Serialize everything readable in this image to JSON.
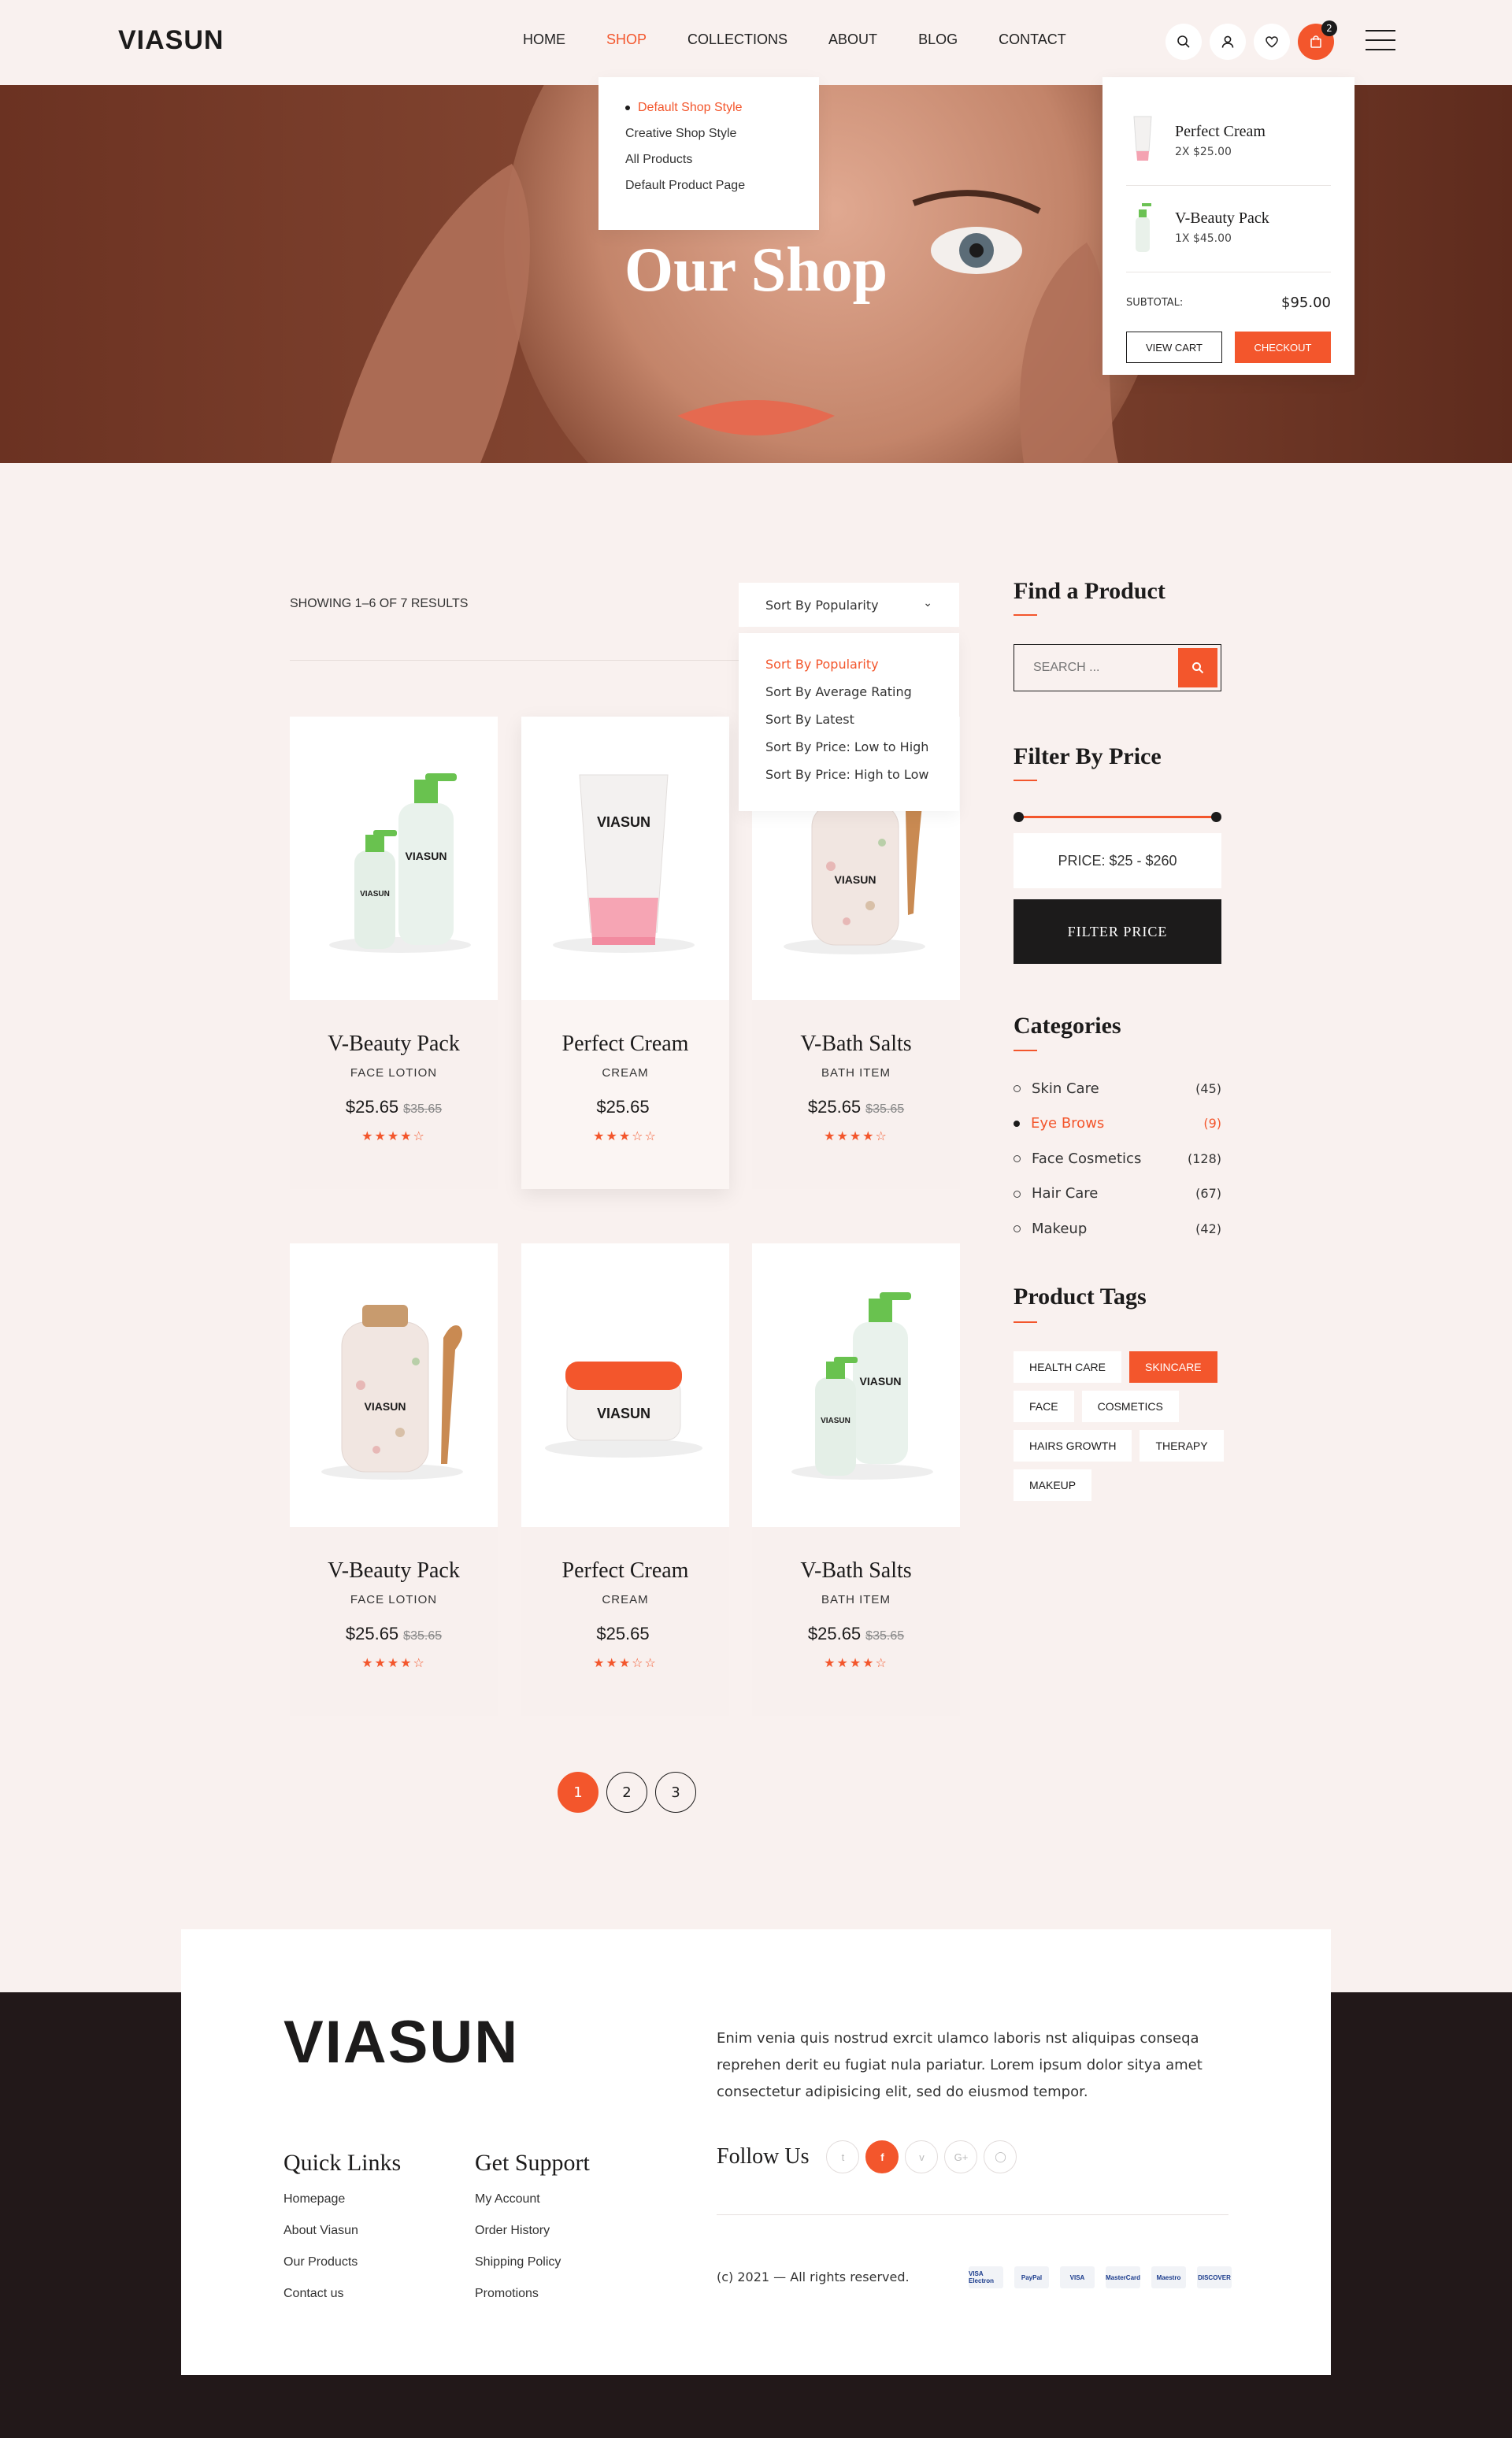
{
  "brand": {
    "logo": "VIASUN"
  },
  "nav": {
    "items": [
      "HOME",
      "SHOP",
      "COLLECTIONS",
      "ABOUT",
      "BLOG",
      "CONTACT"
    ],
    "active_index": 1
  },
  "shop_dropdown": {
    "items": [
      "Default Shop Style",
      "Creative Shop Style",
      "All Products",
      "Default Product Page"
    ]
  },
  "header_icons": [
    "search-icon",
    "user-icon",
    "heart-icon",
    "cart-icon"
  ],
  "cart": {
    "count": "2",
    "items": [
      {
        "name": "Perfect Cream",
        "qty": "2X $25.00"
      },
      {
        "name": "V-Beauty Pack",
        "qty": "1X $45.00"
      }
    ],
    "subtotal_label": "SUBTOTAL:",
    "subtotal": "$95.00",
    "view_cart": "VIEW CART",
    "checkout": "CHECKOUT"
  },
  "hero": {
    "title": "Our Shop"
  },
  "toolbar": {
    "result_count": "SHOWING 1–6 OF 7 RESULTS",
    "sort_selected": "Sort By Popularity",
    "sort_options": [
      "Sort By Popularity",
      "Sort By Average Rating",
      "Sort By Latest",
      "Sort By Price: Low to High",
      "Sort By Price: High to Low"
    ]
  },
  "products": [
    {
      "name": "V-Beauty Pack",
      "category": "FACE LOTION",
      "price": "$25.65",
      "old_price": "$35.65",
      "rating": 4
    },
    {
      "name": "Perfect Cream",
      "category": "CREAM",
      "price": "$25.65",
      "old_price": "",
      "rating": 3
    },
    {
      "name": "V-Bath Salts",
      "category": "BATH ITEM",
      "price": "$25.65",
      "old_price": "$35.65",
      "rating": 4
    },
    {
      "name": "V-Beauty Pack",
      "category": "FACE LOTION",
      "price": "$25.65",
      "old_price": "$35.65",
      "rating": 4
    },
    {
      "name": "Perfect Cream",
      "category": "CREAM",
      "price": "$25.65",
      "old_price": "",
      "rating": 3
    },
    {
      "name": "V-Bath Salts",
      "category": "BATH ITEM",
      "price": "$25.65",
      "old_price": "$35.65",
      "rating": 4
    }
  ],
  "pagination": {
    "pages": [
      "1",
      "2",
      "3"
    ],
    "current": "1"
  },
  "sidebar": {
    "find_title": "Find a Product",
    "search_placeholder": "SEARCH ...",
    "price_title": "Filter By Price",
    "price_label": "PRICE: $25 - $260",
    "filter_button": "FILTER PRICE",
    "categories_title": "Categories",
    "categories": [
      {
        "name": "Skin Care",
        "count": "(45)"
      },
      {
        "name": "Eye Brows",
        "count": "(9)"
      },
      {
        "name": "Face Cosmetics",
        "count": "(128)"
      },
      {
        "name": "Hair Care",
        "count": "(67)"
      },
      {
        "name": "Makeup",
        "count": "(42)"
      }
    ],
    "active_category": 1,
    "tags_title": "Product Tags",
    "tags": [
      "HEALTH CARE",
      "SKINCARE",
      "FACE",
      "COSMETICS",
      "HAIRS GROWTH",
      "THERAPY",
      "MAKEUP"
    ],
    "active_tag": 1
  },
  "footer": {
    "logo": "VIASUN",
    "about": "Enim venia quis nostrud exrcit ulamco laboris nst aliquipas conseqa reprehen derit eu fugiat nula pariatur. Lorem ipsum dolor sitya amet consectetur adipisicing elit, sed do eiusmod tempor.",
    "quick_links_title": "Quick Links",
    "quick_links": [
      "Homepage",
      "About Viasun",
      "Our Products",
      "Contact us"
    ],
    "support_title": "Get Support",
    "support_links": [
      "My Account",
      "Order History",
      "Shipping Policy",
      "Promotions"
    ],
    "follow_label": "Follow Us",
    "socials": [
      "twitter-icon",
      "facebook-icon",
      "vimeo-icon",
      "google-plus-icon",
      "instagram-icon"
    ],
    "copyright": "(c) 2021 — All rights reserved.",
    "payments": [
      "VISA Electron",
      "PayPal",
      "VISA",
      "MasterCard",
      "Maestro",
      "DISCOVER"
    ]
  },
  "colors": {
    "accent": "#f3562c",
    "dark": "#1c1b1b",
    "background": "#f9f1ef",
    "footer": "#221819"
  }
}
